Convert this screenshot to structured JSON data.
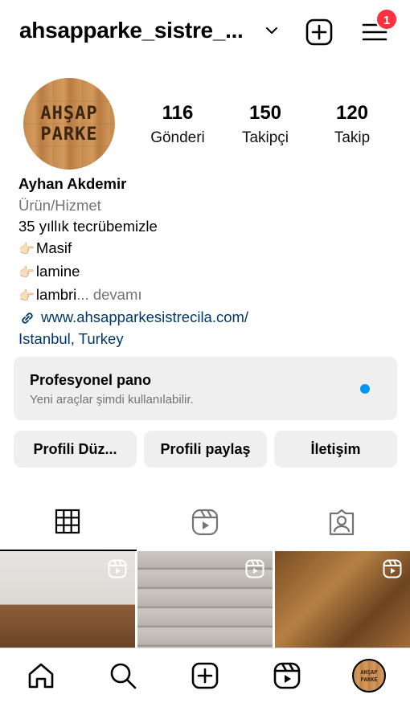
{
  "header": {
    "username": "ahsapparke_sistre_...",
    "notification_count": "1"
  },
  "profile": {
    "avatar_line1": "AHŞAP",
    "avatar_line2": "PARKE",
    "stats": [
      {
        "value": "116",
        "label": "Gönderi"
      },
      {
        "value": "150",
        "label": "Takipçi"
      },
      {
        "value": "120",
        "label": "Takip"
      }
    ],
    "name": "Ayhan Akdemir",
    "category": "Ürün/Hizmet",
    "bio_line1": "35 yıllık tecrübemizle",
    "bio_line2": "Masif",
    "bio_line3": "lamine",
    "bio_line4": "lambri",
    "more_label": "... devamı",
    "website": "www.ahsapparkesistrecila.com/",
    "location": "Istanbul, Turkey"
  },
  "dashboard": {
    "title": "Profesyonel pano",
    "subtitle": "Yeni araçlar şimdi kullanılabilir."
  },
  "buttons": {
    "edit": "Profili Düz...",
    "share": "Profili paylaş",
    "contact": "İletişim"
  },
  "colors": {
    "link": "#00376b",
    "badge": "#ff3040",
    "accent_dot": "#0095f6",
    "secondary_text": "#737373",
    "button_bg": "#efefef"
  },
  "icons": {
    "header": [
      "chevron-down-icon",
      "create-plus-icon",
      "menu-icon"
    ],
    "tabs": [
      "grid-icon",
      "reels-icon",
      "tagged-icon"
    ],
    "nav": [
      "home-icon",
      "search-icon",
      "create-icon",
      "reels-icon",
      "profile-avatar"
    ]
  }
}
